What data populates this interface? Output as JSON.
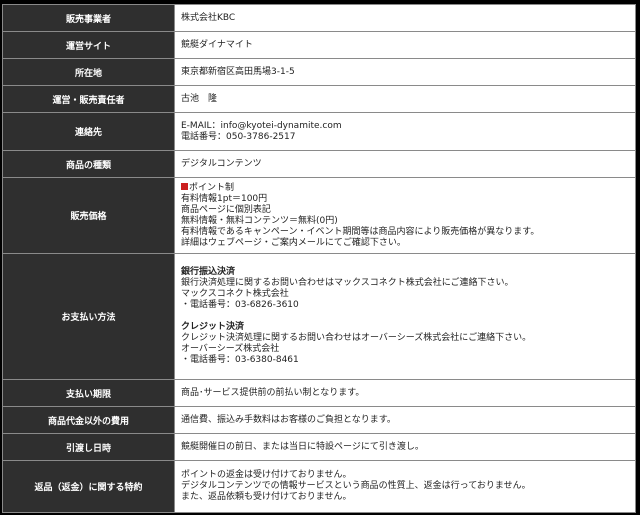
{
  "rows": [
    {
      "label": "販売事業者",
      "lines": [
        "株式会社KBC"
      ]
    },
    {
      "label": "運営サイト",
      "lines": [
        "競艇ダイナマイト"
      ]
    },
    {
      "label": "所在地",
      "lines": [
        "東京都新宿区高田馬場3-1-5"
      ]
    },
    {
      "label": "運営・販売責任者",
      "lines": [
        "古池　隆"
      ]
    },
    {
      "label": "連絡先",
      "lines": [
        "E-MAIL：info@kyotei-dynamite.com",
        "電話番号：050-3786-2517"
      ]
    },
    {
      "label": "商品の種類",
      "lines": [
        "デジタルコンテンツ"
      ]
    },
    {
      "label": "販売価格",
      "lines": [
        "ポイント制",
        "有料情報1pt＝100円",
        "商品ページに個別表記",
        "無料情報・無料コンテンツ＝無料(0円)",
        "有料情報であるキャンペーン・イベント期間等は商品内容により販売価格が異なります。",
        "詳細はウェブページ・ご案内メールにてご確認下さい。"
      ]
    },
    {
      "label": "お支払い方法",
      "bank": {
        "heading": "銀行振込決済",
        "lines": [
          "銀行決済処理に関するお問い合わせはマックスコネクト株式会社にご連絡下さい。",
          "マックスコネクト株式会社",
          "・電話番号：03-6826-3610"
        ]
      },
      "credit": {
        "heading": "クレジット決済",
        "lines": [
          "クレジット決済処理に関するお問い合わせはオーバーシーズ株式会社にご連絡下さい。",
          "オーバーシーズ株式会社",
          "・電話番号：03-6380-8461"
        ]
      }
    },
    {
      "label": "支払い期限",
      "lines": [
        "商品･サービス提供前の前払い制となります。"
      ]
    },
    {
      "label": "商品代金以外の費用",
      "lines": [
        "通信費、振込み手数料はお客様のご負担となります。"
      ]
    },
    {
      "label": "引渡し日時",
      "lines": [
        "競艇開催日の前日、または当日に特設ページにて引き渡し。"
      ]
    },
    {
      "label": "返品（返金）に関する特約",
      "lines": [
        "ポイントの返金は受け付けておりません。",
        "デジタルコンテンツでの情報サービスという商品の性質上、返金は行っておりません。",
        "また、返品依頼も受け付けておりません。"
      ]
    }
  ],
  "colors": {
    "label_bg": "#2f2f2f",
    "bullet": "#cc1f1f",
    "border": "#8a8a8a"
  }
}
